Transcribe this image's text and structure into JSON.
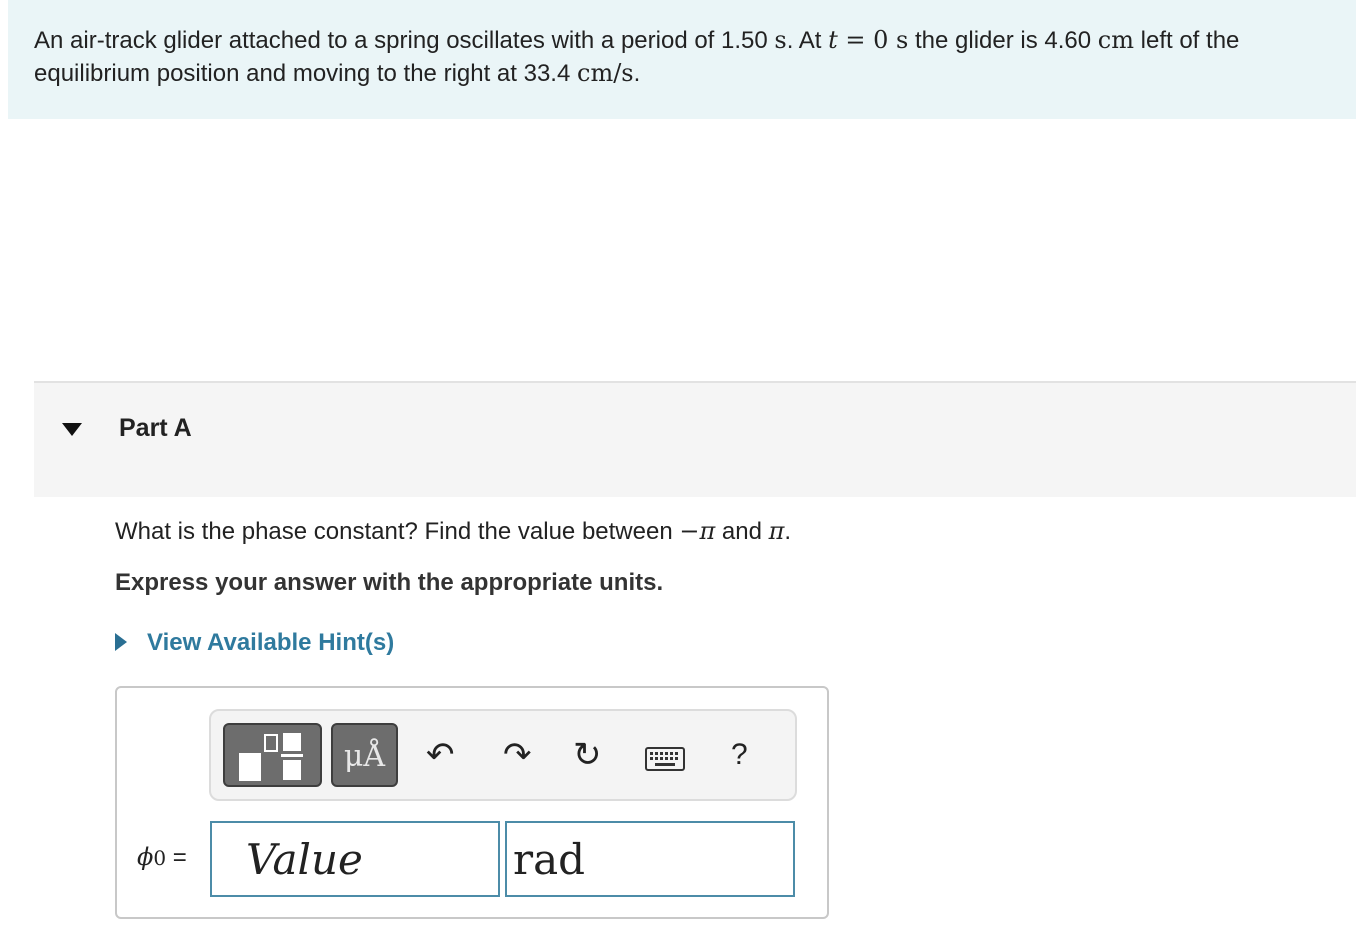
{
  "problem": {
    "text_part1": "An air-track glider attached to a spring oscillates with a period of 1.50 ",
    "unit_s": "s",
    "text_part2": ". At ",
    "var_t": "t",
    "eq_zero": " = 0 ",
    "unit_s2": "s",
    "text_part3": " the glider is 4.60 ",
    "unit_cm": "cm",
    "text_part4": " left of the equilibrium position and moving to the right at 33.4 ",
    "unit_cms": "cm/s",
    "text_part5": "."
  },
  "part": {
    "title": "Part A",
    "question_part1": "What is the phase constant? Find the value between ",
    "neg_pi": "−π",
    "question_and": " and ",
    "pi": "π",
    "question_end": ".",
    "instructions": "Express your answer with the appropriate units.",
    "hint_link": "View Available Hint(s)"
  },
  "toolbar": {
    "templates_icon": "templates-icon",
    "units_label": "μÅ",
    "undo_icon": "↶",
    "redo_icon": "↷",
    "reset_icon": "↻",
    "keyboard_icon": "keyboard-icon",
    "help_label": "?"
  },
  "answer": {
    "phi_symbol": "ϕ",
    "phi_subscript": "0",
    "equals": "=",
    "value_placeholder": "Value",
    "unit_value": "rad"
  },
  "colors": {
    "problem_bg": "#eaf5f7",
    "link": "#2f7a9e",
    "input_border": "#4c8ca8"
  }
}
